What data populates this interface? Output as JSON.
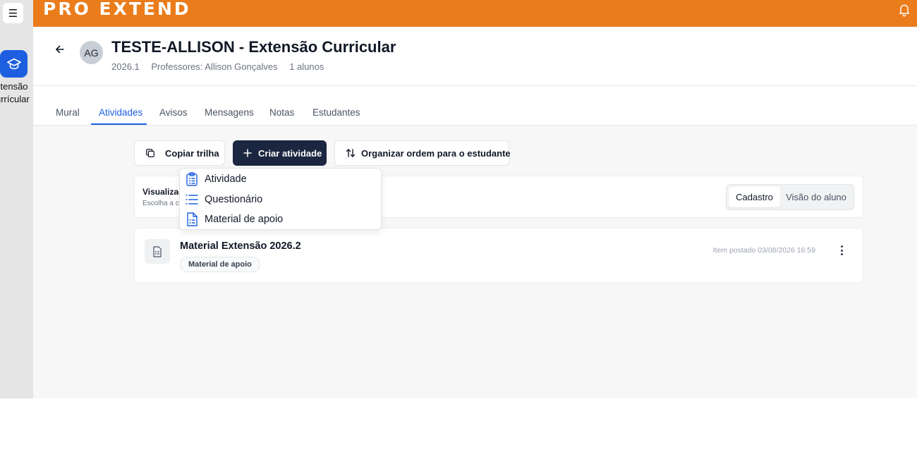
{
  "app": {
    "logo_text": "PRO EXTEND",
    "brand_color": "#ea7c1c",
    "accent_color": "#1d5fe0"
  },
  "rail": {
    "menu_icon": "hamburger-icon",
    "item_icon": "graduation-cap-icon",
    "item_label_line1": "xtensão",
    "item_label_line2": "urrícular"
  },
  "course": {
    "avatar": "AG",
    "title": "TESTE-ALLISON - Extensão Curricular",
    "semester": "2026.1",
    "professors": "Professores: Allison Gonçalves",
    "students": "1 alunos"
  },
  "tabs": [
    {
      "label": "Mural"
    },
    {
      "label": "Atividades",
      "active": true
    },
    {
      "label": "Avisos"
    },
    {
      "label": "Mensagens"
    },
    {
      "label": "Notas"
    },
    {
      "label": "Estudantes"
    }
  ],
  "toolbar": {
    "copy_label": "Copiar trilha",
    "create_label": "Criar atividade",
    "order_label": "Organizar ordem para o estudante"
  },
  "dropdown": {
    "items": [
      {
        "label": "Atividade",
        "icon": "clipboard-list-icon"
      },
      {
        "label": "Questionário",
        "icon": "list-icon"
      },
      {
        "label": "Material de apoio",
        "icon": "document-icon"
      }
    ]
  },
  "visualization": {
    "title": "Visualizaç",
    "subtitle": "Escolha a c",
    "options": [
      "Cadastro",
      "Visão do aluno"
    ],
    "selected": "Cadastro"
  },
  "items": [
    {
      "title": "Material Extensão 2026.2",
      "badge": "Material de apoio",
      "posted": "Item postado 03/08/2026 16:59"
    }
  ]
}
